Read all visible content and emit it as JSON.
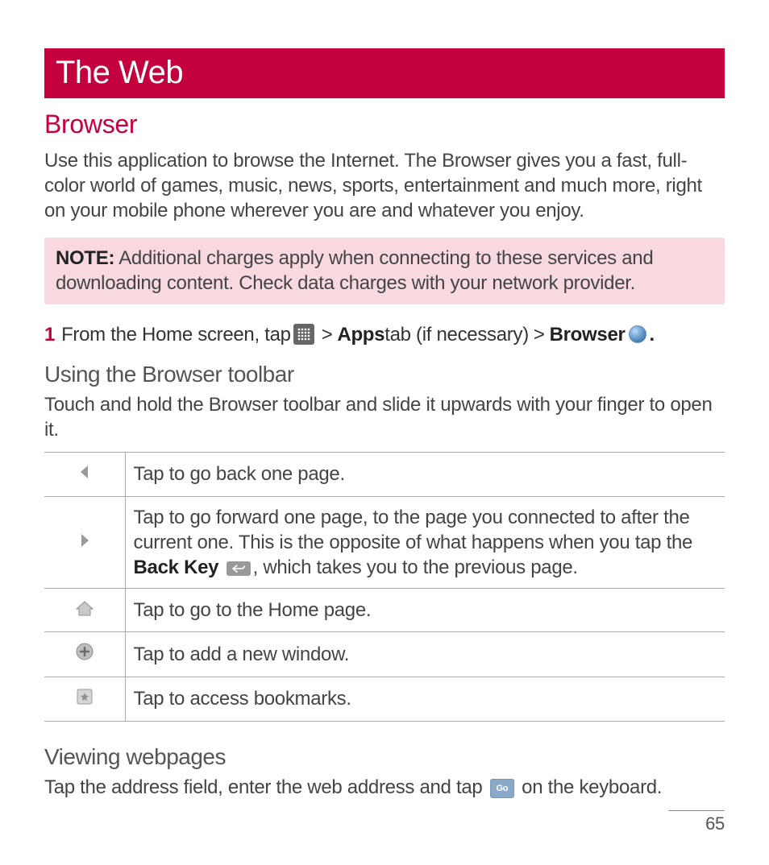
{
  "banner": "The Web",
  "section_title": "Browser",
  "intro": "Use this application to browse the Internet. The Browser gives you a fast, full-color world of games, music, news, sports, entertainment and much more, right on your mobile phone wherever you are and whatever you enjoy.",
  "note_label": "NOTE:",
  "note_text": " Additional charges apply when connecting to these services and downloading content. Check data charges with your network provider.",
  "step": {
    "num": "1",
    "t1": "From the Home screen, tap ",
    "gt1": " > ",
    "apps_bold": "Apps",
    "t2": " tab (if necessary) ",
    "gt2": "> ",
    "browser_bold": "Browser",
    "dot": "."
  },
  "h2_toolbar": "Using the Browser toolbar",
  "toolbar_sub": "Touch and hold the Browser toolbar and slide it upwards with your finger to open it.",
  "rows": {
    "back": "Tap to go back one page.",
    "fwd_a": "Tap to go forward one page, to the page you connected to after the current one. This is the opposite of what happens when you tap the ",
    "fwd_bold1": "Back",
    "fwd_bold2": "Key",
    "fwd_b": ", which takes you to the previous page.",
    "home": "Tap to go to the Home page.",
    "add": "Tap to add a new window.",
    "bookmarks": "Tap to access bookmarks."
  },
  "h2_viewing": "Viewing webpages",
  "viewing": {
    "a": "Tap the address field, enter the web address and tap ",
    "b": " on the keyboard."
  },
  "go_label": "Go",
  "page_number": "65"
}
